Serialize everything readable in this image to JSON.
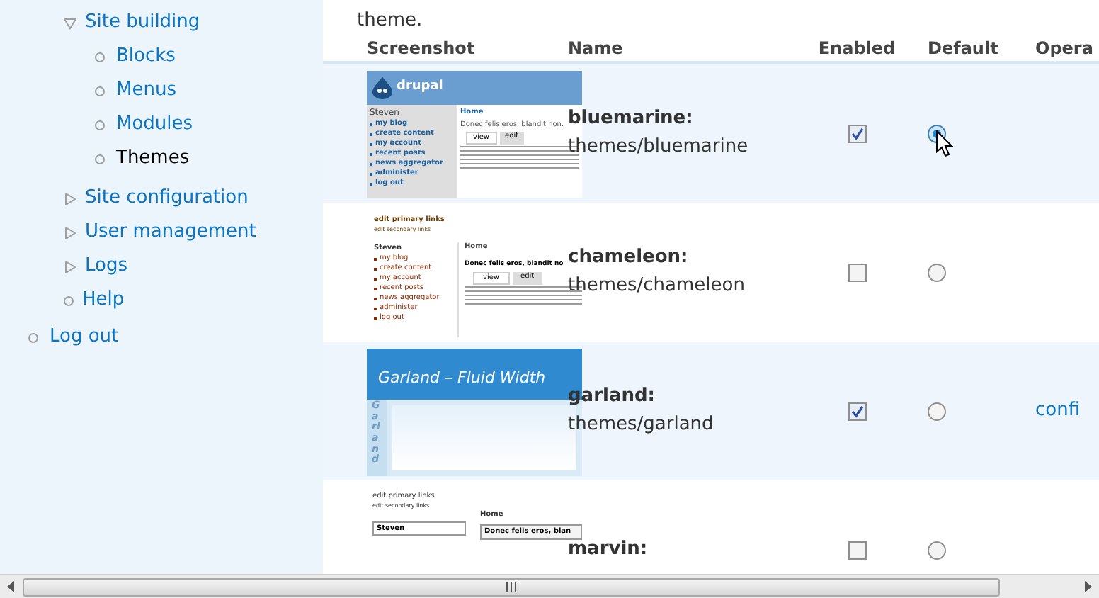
{
  "intro": {
    "text": "theme."
  },
  "sidebar": {
    "items": [
      {
        "label": "Site building",
        "kind": "expandable",
        "expanded": true,
        "children": [
          {
            "label": "Blocks",
            "selected": false
          },
          {
            "label": "Menus",
            "selected": false
          },
          {
            "label": "Modules",
            "selected": false
          },
          {
            "label": "Themes",
            "selected": true
          }
        ]
      },
      {
        "label": "Site configuration",
        "kind": "expandable",
        "expanded": false
      },
      {
        "label": "User management",
        "kind": "expandable",
        "expanded": false
      },
      {
        "label": "Logs",
        "kind": "expandable",
        "expanded": false
      },
      {
        "label": "Help",
        "kind": "leaf"
      }
    ],
    "logout": {
      "label": "Log out"
    }
  },
  "table": {
    "columns": [
      "Screenshot",
      "Name",
      "Enabled",
      "Default",
      "Opera"
    ],
    "rows": [
      {
        "name": "bluemarine:",
        "path": "themes/bluemarine",
        "enabled": true,
        "selected": true,
        "thumbnail": {
          "kind": "bluemarine",
          "logo": "drupal",
          "user": "Steven",
          "links": [
            "my blog",
            "create content",
            "my account",
            "recent posts",
            "news aggregator",
            "administer",
            "log out"
          ],
          "breadcrumb": "Home",
          "title": "Donec felis eros, blandit non.",
          "tabs": [
            "view",
            "edit"
          ]
        }
      },
      {
        "name": "chameleon:",
        "path": "themes/chameleon",
        "enabled": false,
        "selected": false,
        "thumbnail": {
          "kind": "chameleon",
          "primary": "edit primary links",
          "secondary": "edit secondary links",
          "user": "Steven",
          "links": [
            "my blog",
            "create content",
            "my account",
            "recent posts",
            "news aggregator",
            "administer",
            "log out"
          ],
          "breadcrumb": "Home",
          "title": "Donec felis eros, blandit no",
          "tabs": [
            "view",
            "edit"
          ]
        }
      },
      {
        "name": "garland:",
        "path": "themes/garland",
        "enabled": true,
        "selected": false,
        "operation": "confi",
        "thumbnail": {
          "kind": "garland",
          "title": "Garland – Fluid Width",
          "side": "Garland"
        }
      },
      {
        "name": "marvin:",
        "enabled": false,
        "selected": false,
        "thumbnail": {
          "kind": "marvin",
          "primary": "edit primary links",
          "secondary": "edit secondary links",
          "breadcrumb": "Home",
          "user": "Steven",
          "title": "Donec felis eros, blan"
        }
      }
    ]
  }
}
